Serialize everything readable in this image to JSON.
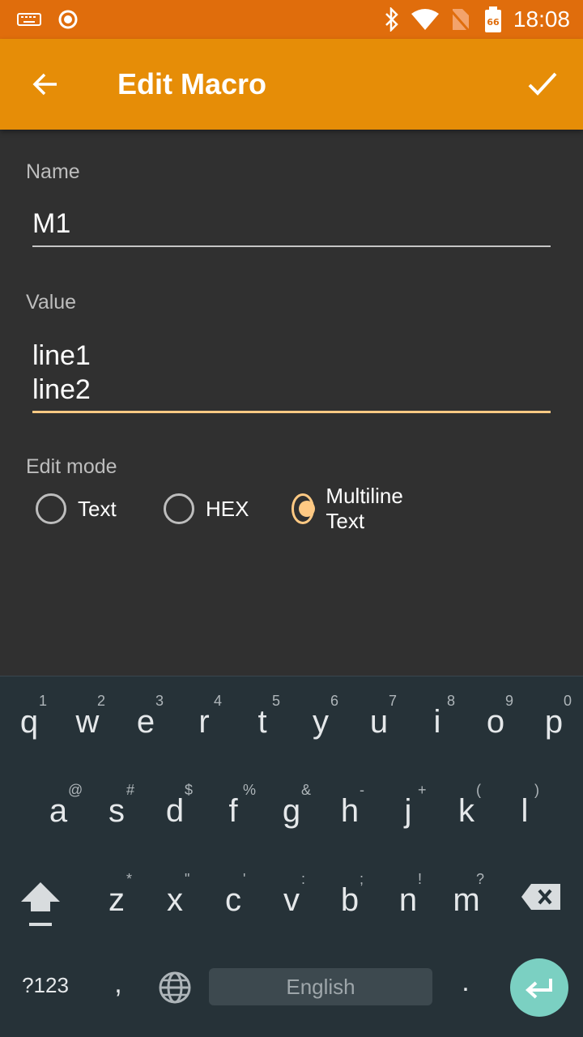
{
  "status_bar": {
    "time": "18:08",
    "icons": [
      "keyboard-icon",
      "record-icon",
      "bluetooth-icon",
      "wifi-icon",
      "no-sim-icon",
      "battery-icon"
    ],
    "battery_level": "66"
  },
  "app_bar": {
    "title": "Edit Macro",
    "back_icon": "arrow-back-icon",
    "confirm_icon": "check-icon"
  },
  "form": {
    "name_label": "Name",
    "name_value": "M1",
    "value_label": "Value",
    "value_text": "line1\nline2",
    "edit_mode_label": "Edit mode",
    "edit_modes": [
      {
        "label": "Text",
        "checked": false
      },
      {
        "label": "HEX",
        "checked": false
      },
      {
        "label": "Multiline Text",
        "checked": true
      }
    ]
  },
  "keyboard": {
    "row1": [
      {
        "key": "q",
        "hint": "1"
      },
      {
        "key": "w",
        "hint": "2"
      },
      {
        "key": "e",
        "hint": "3"
      },
      {
        "key": "r",
        "hint": "4"
      },
      {
        "key": "t",
        "hint": "5"
      },
      {
        "key": "y",
        "hint": "6"
      },
      {
        "key": "u",
        "hint": "7"
      },
      {
        "key": "i",
        "hint": "8"
      },
      {
        "key": "o",
        "hint": "9"
      },
      {
        "key": "p",
        "hint": "0"
      }
    ],
    "row2": [
      {
        "key": "a",
        "hint": "@"
      },
      {
        "key": "s",
        "hint": "#"
      },
      {
        "key": "d",
        "hint": "$"
      },
      {
        "key": "f",
        "hint": "%"
      },
      {
        "key": "g",
        "hint": "&"
      },
      {
        "key": "h",
        "hint": "-"
      },
      {
        "key": "j",
        "hint": "+"
      },
      {
        "key": "k",
        "hint": "("
      },
      {
        "key": "l",
        "hint": ")"
      }
    ],
    "row3": [
      {
        "key": "z",
        "hint": "*"
      },
      {
        "key": "x",
        "hint": "\""
      },
      {
        "key": "c",
        "hint": "'"
      },
      {
        "key": "v",
        "hint": ":"
      },
      {
        "key": "b",
        "hint": ";"
      },
      {
        "key": "n",
        "hint": "!"
      },
      {
        "key": "m",
        "hint": "?"
      }
    ],
    "symbols_label": "?123",
    "comma": ",",
    "space_label": "English",
    "period": ".",
    "shift_icon": "shift-icon",
    "backspace_icon": "backspace-icon",
    "globe_icon": "globe-icon",
    "enter_icon": "enter-icon",
    "accent_color": "#7bd0c2"
  },
  "colors": {
    "status_bar": "#e06d0c",
    "app_bar": "#e68d07",
    "background": "#303030",
    "accent": "#ffc983",
    "keyboard": "#263238"
  }
}
